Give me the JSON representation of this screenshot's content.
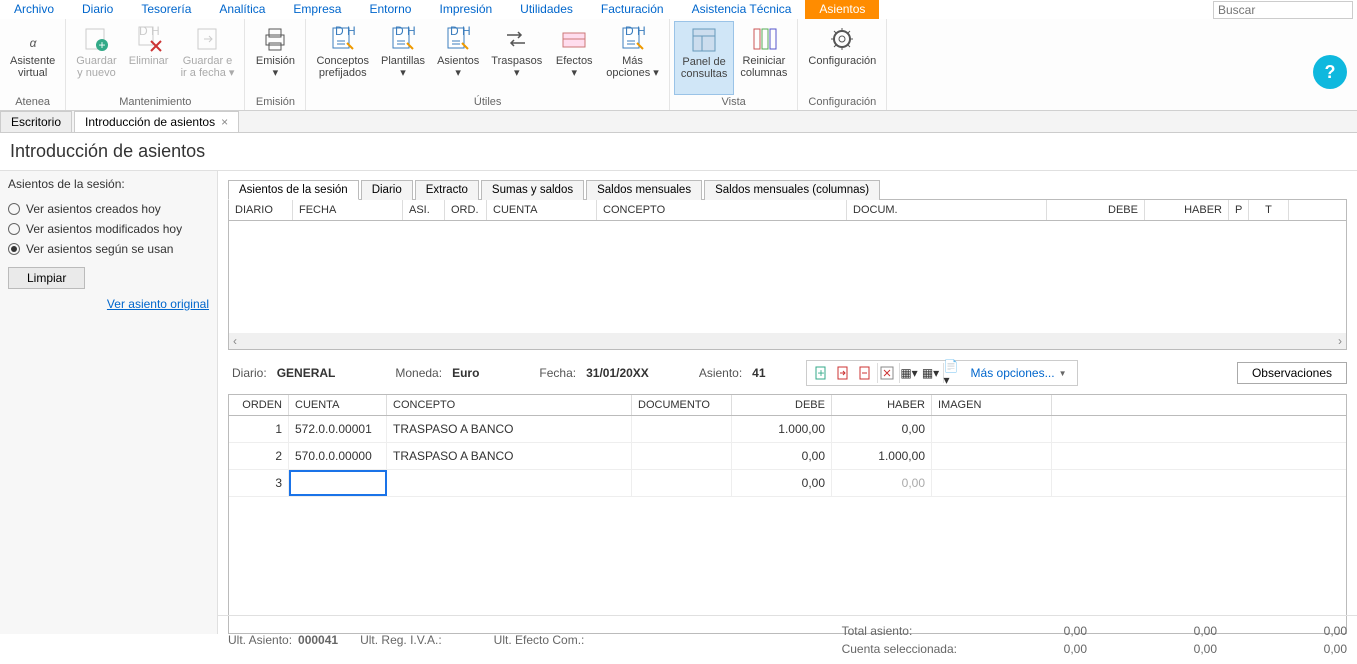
{
  "search_placeholder": "Buscar",
  "menubar": [
    "Archivo",
    "Diario",
    "Tesorería",
    "Analítica",
    "Empresa",
    "Entorno",
    "Impresión",
    "Utilidades",
    "Facturación",
    "Asistencia Técnica",
    "Asientos"
  ],
  "menubar_active": "Asientos",
  "ribbon": {
    "groups": [
      {
        "title": "Atenea",
        "buttons": [
          {
            "label": "Asistente\nvirtual",
            "icon": "alpha"
          }
        ]
      },
      {
        "title": "Mantenimiento",
        "buttons": [
          {
            "label": "Guardar\ny nuevo",
            "icon": "save-new",
            "disabled": true
          },
          {
            "label": "Eliminar",
            "icon": "delete",
            "disabled": true
          },
          {
            "label": "Guardar e\nir a fecha ▾",
            "icon": "save-date",
            "disabled": true
          }
        ]
      },
      {
        "title": "Emisión",
        "buttons": [
          {
            "label": "Emisión\n▾",
            "icon": "print"
          }
        ]
      },
      {
        "title": "Útiles",
        "buttons": [
          {
            "label": "Conceptos\nprefijados",
            "icon": "concepts"
          },
          {
            "label": "Plantillas\n▾",
            "icon": "templates"
          },
          {
            "label": "Asientos\n▾",
            "icon": "entries"
          },
          {
            "label": "Traspasos\n▾",
            "icon": "transfers"
          },
          {
            "label": "Efectos\n▾",
            "icon": "effects"
          },
          {
            "label": "Más\nopciones ▾",
            "icon": "more"
          }
        ]
      },
      {
        "title": "Vista",
        "buttons": [
          {
            "label": "Panel de\nconsultas",
            "icon": "panel",
            "active": true
          },
          {
            "label": "Reiniciar\ncolumnas",
            "icon": "reset-cols"
          }
        ]
      },
      {
        "title": "Configuración",
        "buttons": [
          {
            "label": "Configuración",
            "icon": "gear"
          }
        ]
      }
    ]
  },
  "doc_tabs": [
    {
      "label": "Escritorio"
    },
    {
      "label": "Introducción de asientos",
      "closeable": true,
      "active": true
    }
  ],
  "page_title": "Introducción de asientos",
  "sidebar": {
    "title": "Asientos de la sesión:",
    "radios": [
      {
        "label": "Ver asientos creados hoy",
        "checked": false
      },
      {
        "label": "Ver asientos modificados hoy",
        "checked": false
      },
      {
        "label": "Ver asientos según se usan",
        "checked": true
      }
    ],
    "clear_btn": "Limpiar",
    "original_link": "Ver asiento original"
  },
  "sub_tabs": [
    "Asientos de la sesión",
    "Diario",
    "Extracto",
    "Sumas y saldos",
    "Saldos mensuales",
    "Saldos mensuales (columnas)"
  ],
  "sub_tab_active": "Asientos de la sesión",
  "upper_headers": [
    "DIARIO",
    "FECHA",
    "ASI.",
    "ORD.",
    "CUENTA",
    "CONCEPTO",
    "DOCUM.",
    "DEBE",
    "HABER",
    "P",
    "T"
  ],
  "context": {
    "diario_lbl": "Diario:",
    "diario_val": "GENERAL",
    "moneda_lbl": "Moneda:",
    "moneda_val": "Euro",
    "fecha_lbl": "Fecha:",
    "fecha_val": "31/01/20XX",
    "asiento_lbl": "Asiento:",
    "asiento_val": "41",
    "more_options": "Más opciones...",
    "observations": "Observaciones"
  },
  "lower_headers": [
    "ORDEN",
    "CUENTA",
    "CONCEPTO",
    "DOCUMENTO",
    "DEBE",
    "HABER",
    "IMAGEN"
  ],
  "rows": [
    {
      "orden": "1",
      "cuenta": "572.0.0.00001",
      "concepto": "TRASPASO A BANCO",
      "documento": "",
      "debe": "1.000,00",
      "haber": "0,00",
      "imagen": ""
    },
    {
      "orden": "2",
      "cuenta": "570.0.0.00000",
      "concepto": "TRASPASO A BANCO",
      "documento": "",
      "debe": "0,00",
      "haber": "1.000,00",
      "imagen": ""
    },
    {
      "orden": "3",
      "cuenta": "",
      "concepto": "",
      "documento": "",
      "debe": "0,00",
      "haber": "0,00",
      "imagen": "",
      "haber_gray": true
    }
  ],
  "footer": {
    "ult_asiento_lbl": "Ult. Asiento:",
    "ult_asiento_val": "000041",
    "ult_reg_iva": "Ult. Reg. I.V.A.:",
    "ult_efecto": "Ult. Efecto Com.:",
    "total_asiento_lbl": "Total asiento:",
    "cuenta_sel_lbl": "Cuenta seleccionada:",
    "zeros": [
      "0,00",
      "0,00",
      "0,00",
      "0,00",
      "0,00",
      "0,00"
    ]
  }
}
